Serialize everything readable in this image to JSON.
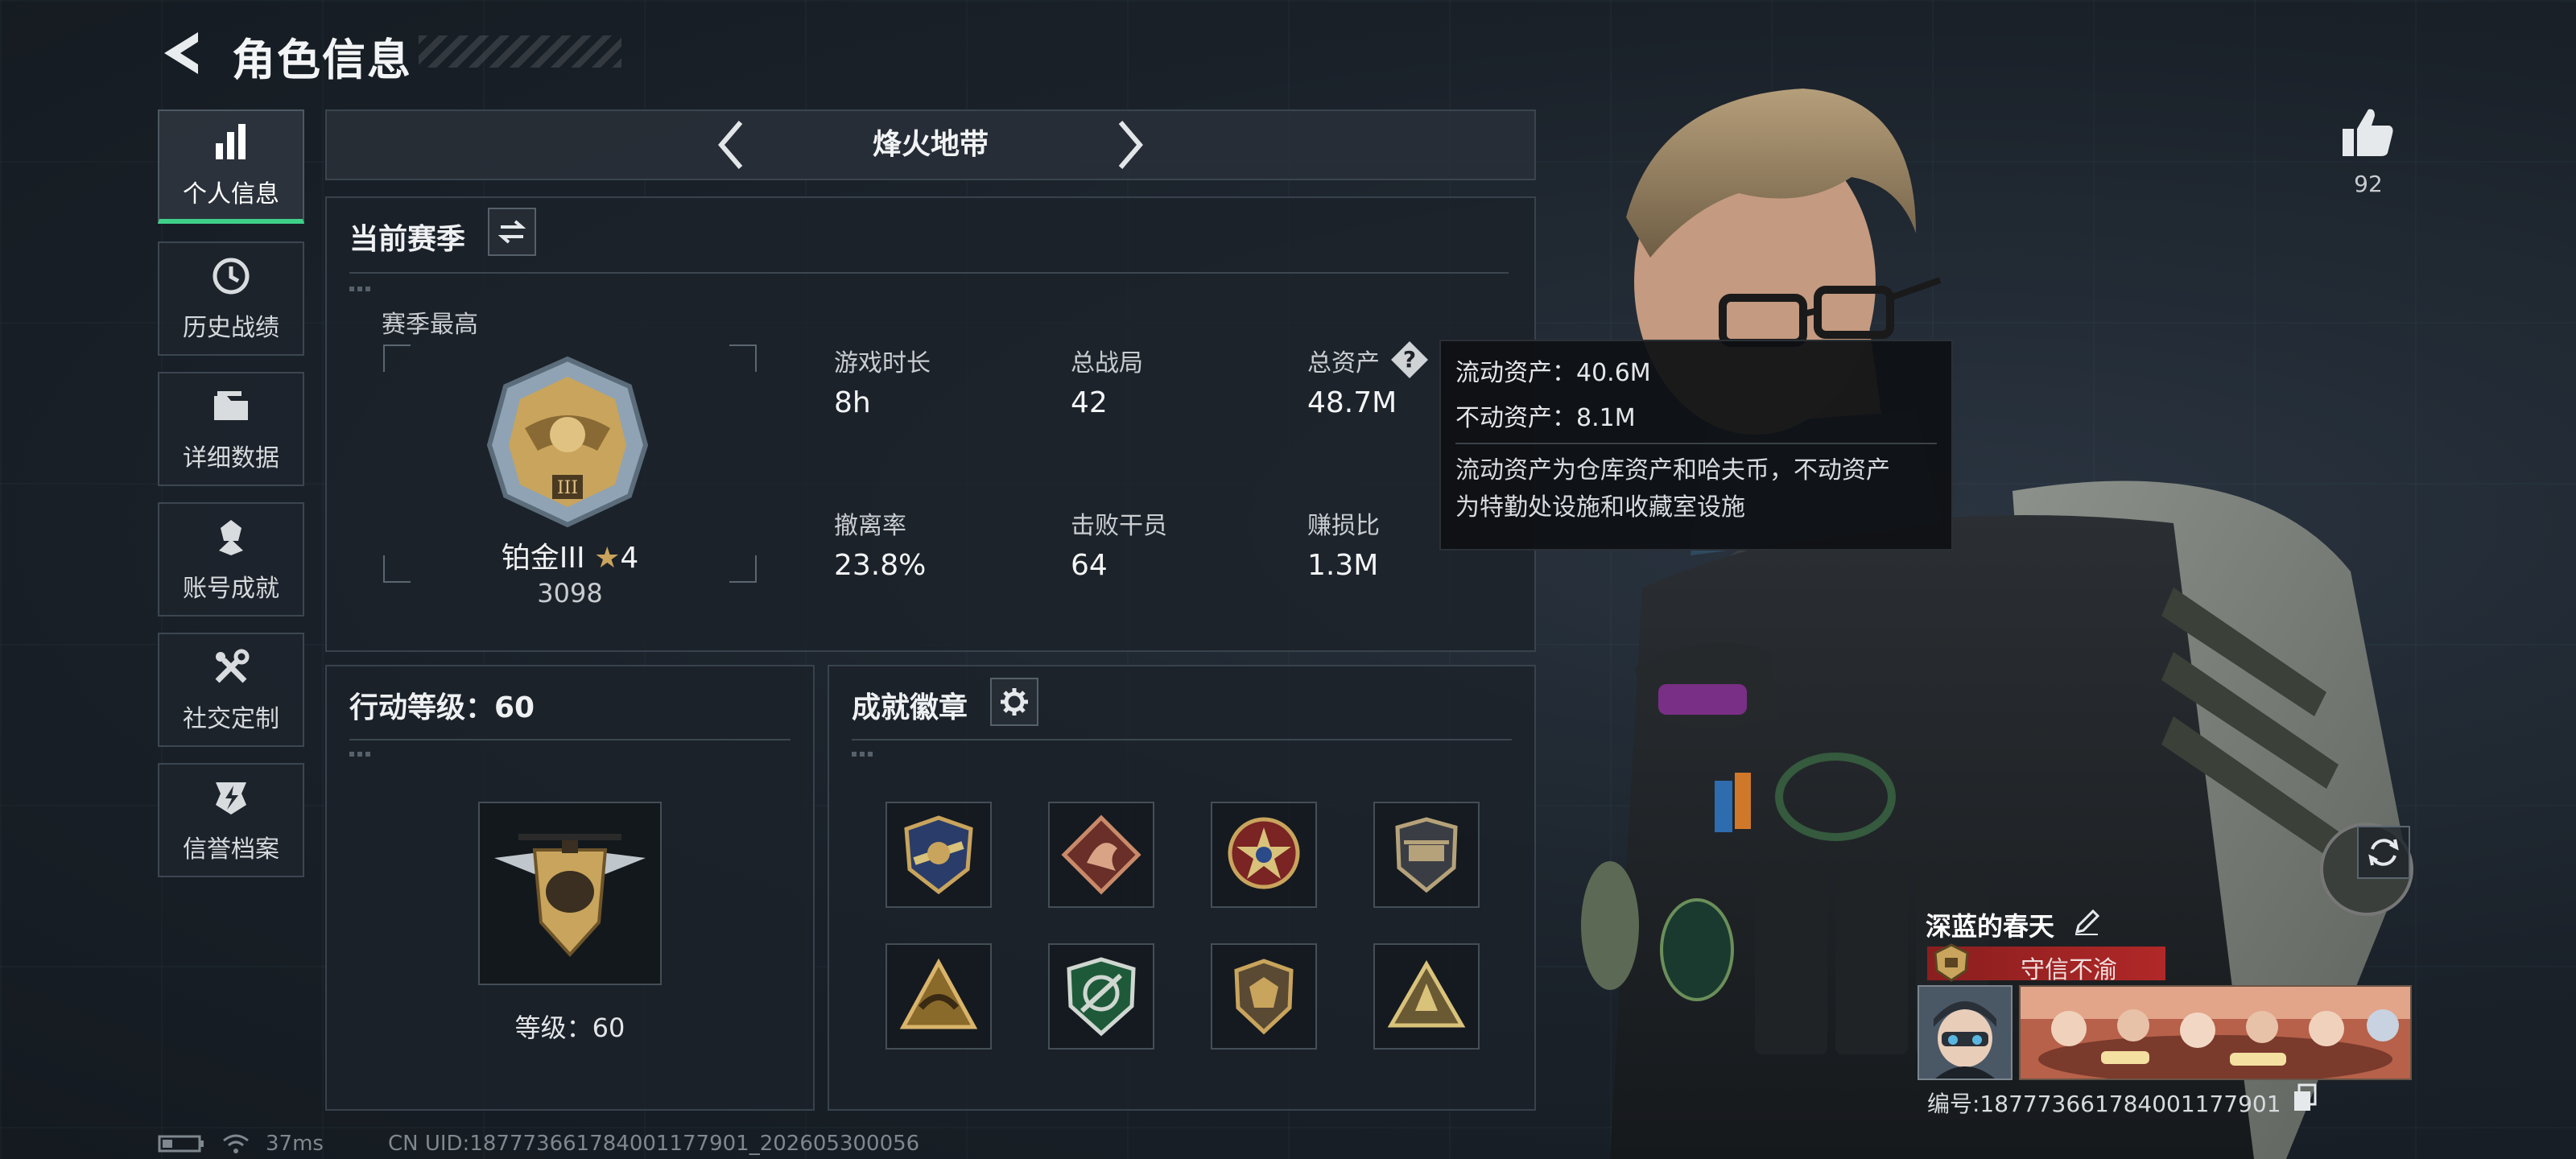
{
  "header": {
    "title": "角色信息"
  },
  "nav": [
    {
      "label": "个人信息",
      "icon": "bar-chart-icon",
      "active": true
    },
    {
      "label": "历史战绩",
      "icon": "history-icon",
      "active": false
    },
    {
      "label": "详细数据",
      "icon": "folder-icon",
      "active": false
    },
    {
      "label": "账号成就",
      "icon": "medal-icon",
      "active": false
    },
    {
      "label": "社交定制",
      "icon": "tools-icon",
      "active": false
    },
    {
      "label": "信誉档案",
      "icon": "reputation-icon",
      "active": false
    }
  ],
  "mode": {
    "title": "烽火地带"
  },
  "season": {
    "title": "当前赛季",
    "best_label": "赛季最高",
    "rank_name": "铂金III",
    "rank_stars": "4",
    "rank_score": "3098",
    "stats": [
      {
        "label": "游戏时长",
        "value": "8h"
      },
      {
        "label": "总战局",
        "value": "42"
      },
      {
        "label": "总资产",
        "value": "48.7M"
      },
      {
        "label": "撤离率",
        "value": "23.8%"
      },
      {
        "label": "击败干员",
        "value": "64"
      },
      {
        "label": "赚损比",
        "value": "1.3M"
      }
    ]
  },
  "tooltip": {
    "liquid": "流动资产：40.6M",
    "fixed": "不动资产：8.1M",
    "desc_line1": "流动资产为仓库资产和哈夫币，不动资产",
    "desc_line2": "为特勤处设施和收藏室设施"
  },
  "level": {
    "title": "行动等级：60",
    "label": "等级：60"
  },
  "badges": {
    "title": "成就徽章",
    "items": [
      "badge-1",
      "badge-2",
      "badge-3",
      "badge-4",
      "badge-5",
      "badge-6",
      "badge-7",
      "badge-8"
    ]
  },
  "profile": {
    "likes": "92",
    "name": "深蓝的春天",
    "title": "守信不渝",
    "id": "编号:187773661784001177901"
  },
  "status": {
    "ping": "37ms",
    "uid": "CN UID:187773661784001177901_202605300056"
  },
  "colors": {
    "accent": "#3ed08a",
    "title_red": "#b12828",
    "gold": "#c9a45c"
  }
}
